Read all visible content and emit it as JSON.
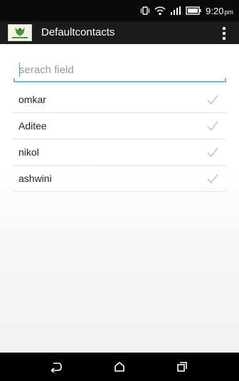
{
  "status_bar": {
    "time": "9:20",
    "ampm": "pm",
    "icons": [
      "vibrate-icon",
      "wifi-icon",
      "signal-icon",
      "battery-icon"
    ]
  },
  "action_bar": {
    "logo_icon": "app-logo-icon",
    "title": "Defaultcontacts",
    "menu_icon": "overflow-menu-icon"
  },
  "search": {
    "placeholder": "serach field",
    "value": ""
  },
  "contacts": [
    {
      "name": "omkar",
      "checked": false
    },
    {
      "name": "Aditee",
      "checked": false
    },
    {
      "name": "nikol",
      "checked": false
    },
    {
      "name": "ashwini",
      "checked": false
    }
  ],
  "nav_bar": {
    "buttons": [
      "back-icon",
      "home-icon",
      "recent-apps-icon"
    ]
  },
  "colors": {
    "action_bar": "#1b1b1b",
    "status_bar": "#0a0a0a",
    "search_underline": "#6fb8d2",
    "checkmark": "#d0d0d0"
  }
}
